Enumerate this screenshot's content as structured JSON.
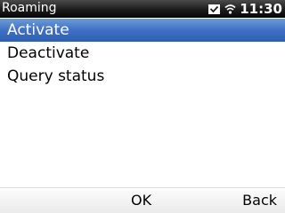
{
  "status_bar": {
    "title": "Roaming",
    "time": "11:30",
    "icons": [
      "notification-icon",
      "wifi-icon"
    ]
  },
  "menu": {
    "items": [
      {
        "label": "Activate",
        "selected": true
      },
      {
        "label": "Deactivate",
        "selected": false
      },
      {
        "label": "Query status",
        "selected": false
      }
    ]
  },
  "softkeys": {
    "left": "",
    "center": "OK",
    "right": "Back"
  },
  "colors": {
    "selection": "#3f70c4",
    "status_bar": "#1c1c1c",
    "background": "#ffffff"
  }
}
